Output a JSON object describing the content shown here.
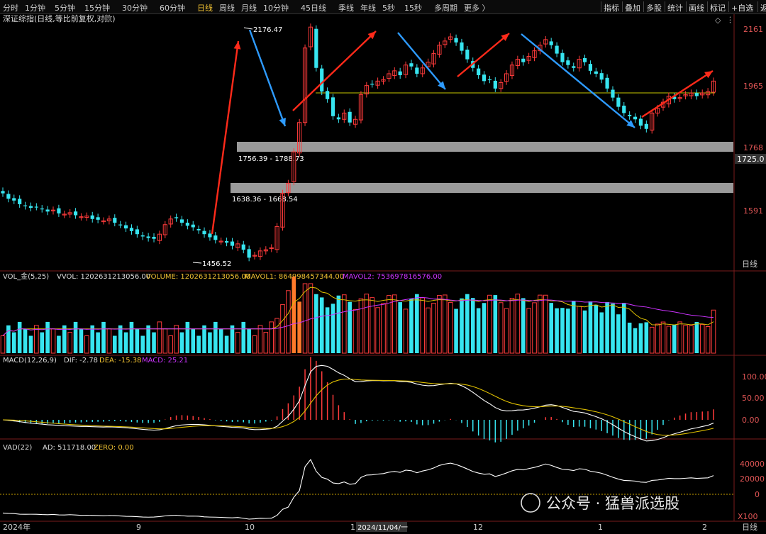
{
  "toolbar": {
    "periods": [
      "分时",
      "1分钟",
      "5分钟",
      "15分钟",
      "30分钟",
      "60分钟",
      "日线",
      "周线",
      "月线",
      "10分钟",
      "45日线",
      "季线",
      "年线",
      "5秒",
      "15秒",
      "多周期",
      "更多 〉"
    ],
    "active_period": "日线",
    "tools": [
      "指标",
      "叠加",
      "多股",
      "统计",
      "画线",
      "标记",
      "+自选",
      "返回"
    ]
  },
  "chart_title": "深证综指(日线,等比前复权,对数)",
  "price_axis": [
    "2161",
    "1965",
    "1768",
    "1591"
  ],
  "price_tag": "1725.0",
  "period_label": "日线",
  "annotations": {
    "high": "2176.47",
    "low": "1456.52",
    "gap1": "1756.39 - 1788.73",
    "gap2": "1638.36 - 1668.54"
  },
  "vol_header": {
    "name": "VOL_金(5,25)",
    "vvol": "VVOL: 1202631213056.00",
    "volume": "VOLUME: 1202631213056.00",
    "mavol1": "MAVOL1: 864998457344.00",
    "mavol2": "MAVOL2: 753697816576.00"
  },
  "macd_header": {
    "name": "MACD(12,26,9)",
    "dif": "DIF: -2.78",
    "dea": "DEA: -15.38",
    "macd": "MACD: 25.21"
  },
  "macd_axis": [
    "100.00",
    "50.00",
    "0.00"
  ],
  "vad_header": {
    "name": "VAD(22)",
    "ad": "AD: 511718.00",
    "zero": "ZERO: 0.00"
  },
  "vad_axis": [
    "40000",
    "20000",
    "0"
  ],
  "vad_unit": "X100",
  "date_axis": [
    "2024年",
    "9",
    "10",
    "11",
    "12",
    "1",
    "2"
  ],
  "crosshair_date": "2024/11/04/一",
  "watermark": "公众号 · 猛兽派选股",
  "colors": {
    "up": "#ff3b3b",
    "down": "#37e5f0",
    "ma": "#e0c000",
    "mavol2": "#cc33ff",
    "arrow_up": "#ff2a1a",
    "arrow_down": "#2e9bff"
  },
  "chart_data": {
    "type": "candlestick",
    "title": "深证综指(日线,等比前复权,对数)",
    "ohlc_approx_close": [
      1640,
      1625,
      1620,
      1610,
      1605,
      1600,
      1603,
      1597,
      1590,
      1594,
      1585,
      1583,
      1587,
      1580,
      1576,
      1578,
      1570,
      1568,
      1565,
      1570,
      1560,
      1555,
      1545,
      1538,
      1530,
      1524,
      1520,
      1518,
      1530,
      1555,
      1570,
      1572,
      1560,
      1552,
      1548,
      1540,
      1530,
      1522,
      1515,
      1512,
      1508,
      1500,
      1505,
      1490,
      1470,
      1476,
      1487,
      1490,
      1495,
      1550,
      1640,
      1668,
      1760,
      1850,
      2100,
      2176,
      2030,
      1950,
      1925,
      1870,
      1860,
      1880,
      1850,
      1860,
      1940,
      1970,
      1975,
      1985,
      1990,
      2010,
      2020,
      2005,
      2040,
      2035,
      2010,
      2030,
      2050,
      2080,
      2110,
      2125,
      2140,
      2120,
      2090,
      2060,
      2030,
      2005,
      1985,
      1990,
      1960,
      1980,
      2010,
      2040,
      2060,
      2050,
      2070,
      2090,
      2110,
      2130,
      2110,
      2080,
      2050,
      2040,
      2030,
      2060,
      2050,
      2020,
      2010,
      1990,
      1960,
      1930,
      1900,
      1880,
      1870,
      1860,
      1840,
      1830,
      1880,
      1895,
      1915,
      1935,
      1925,
      1930,
      1940,
      1945,
      1935,
      1945,
      1950,
      1985
    ],
    "annotations": {
      "high": 2176.47,
      "low": 1456.52
    },
    "gaps": [
      [
        1756.39,
        1788.73
      ],
      [
        1638.36,
        1668.54
      ]
    ],
    "horizontal_line": 1920,
    "x_ticks": [
      "2024年",
      "9",
      "10",
      "11",
      "12",
      "1",
      "2"
    ]
  }
}
